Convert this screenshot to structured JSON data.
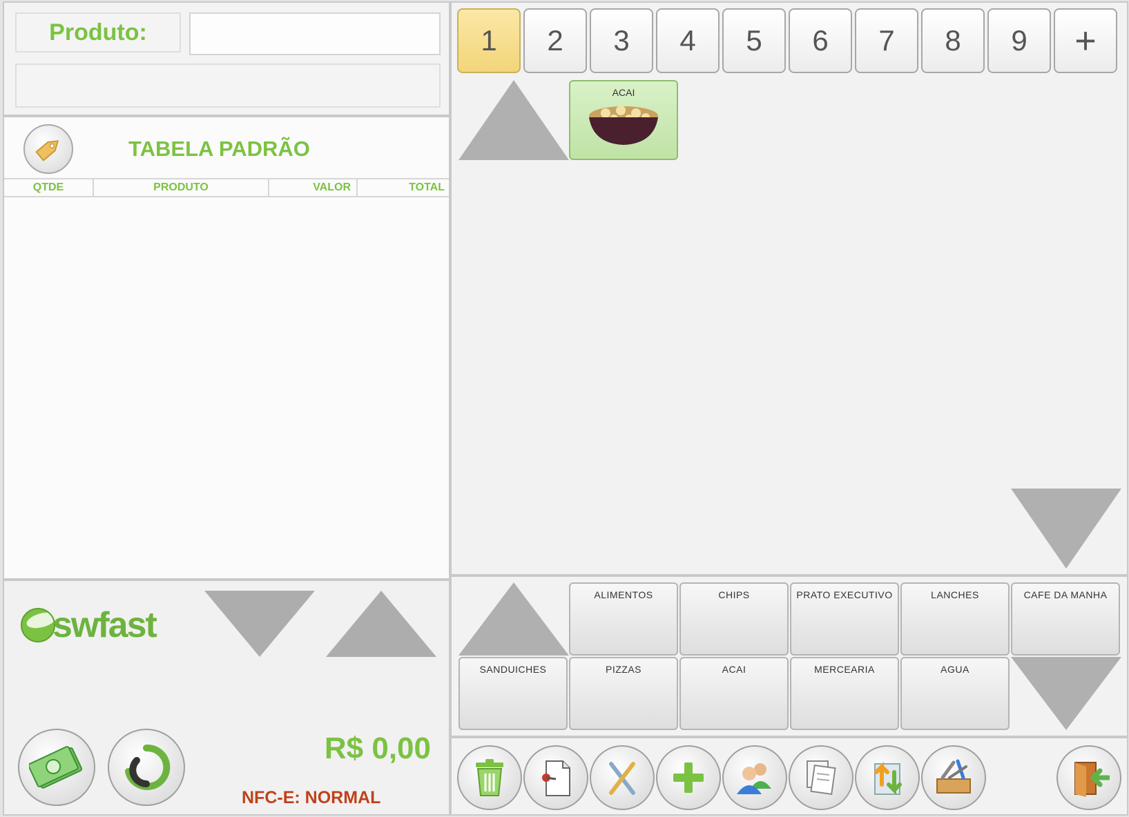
{
  "product_search": {
    "label": "Produto:",
    "input_value": "",
    "description": ""
  },
  "order": {
    "price_table_title": "TABELA PADRÃO",
    "columns": [
      "QTDE",
      "PRODUTO",
      "VALOR",
      "TOTAL"
    ],
    "items": []
  },
  "footer": {
    "logo_text": "swfast",
    "total": "R$ 0,00",
    "nfce_status": "NFC-E: NORMAL"
  },
  "tabs": [
    "1",
    "2",
    "3",
    "4",
    "5",
    "6",
    "7",
    "8",
    "9",
    "+"
  ],
  "active_tab": "1",
  "products": [
    {
      "label": "ACAI"
    }
  ],
  "categories": [
    "ALIMENTOS",
    "CHIPS",
    "PRATO EXECUTIVO",
    "LANCHES",
    "CAFE DA MANHA",
    "SANDUICHES",
    "PIZZAS",
    "ACAI",
    "MERCEARIA",
    "AGUA"
  ],
  "actions": [
    {
      "icon": "trash-icon"
    },
    {
      "icon": "document-pin-icon"
    },
    {
      "icon": "cutlery-icon"
    },
    {
      "icon": "plus-icon"
    },
    {
      "icon": "users-icon"
    },
    {
      "icon": "copy-documents-icon"
    },
    {
      "icon": "transfer-arrows-icon"
    },
    {
      "icon": "toolbox-icon"
    },
    {
      "icon": "exit-door-icon"
    }
  ],
  "colors": {
    "accent_green": "#7cc242",
    "status_red": "#c0411b",
    "active_tab": "#f3d57a"
  }
}
